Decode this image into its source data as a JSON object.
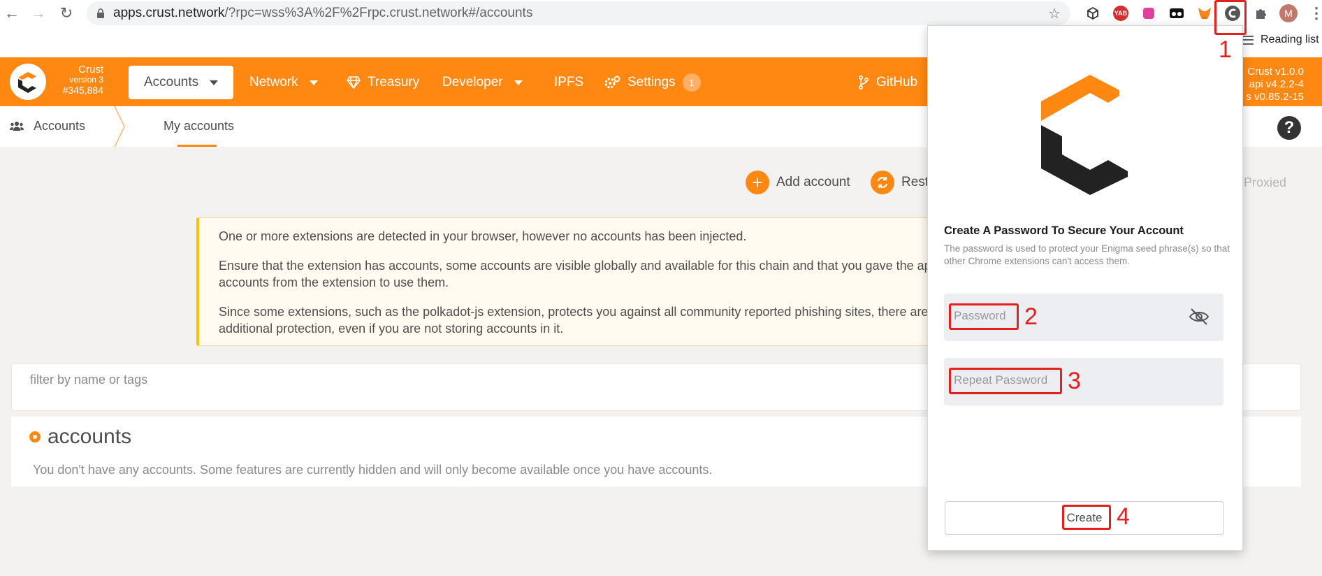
{
  "browser": {
    "url_host": "apps.crust.network",
    "url_path": "/?rpc=wss%3A%2F%2Frpc.crust.network#/accounts",
    "reading_list": "Reading list",
    "profile_initial": "M",
    "ext_yab_label": "YAB"
  },
  "header": {
    "chain_name": "Crust",
    "chain_version": "version 3",
    "block": "#345,884",
    "menu": {
      "accounts": "Accounts",
      "network": "Network",
      "treasury": "Treasury",
      "developer": "Developer",
      "ipfs": "IPFS",
      "settings": "Settings",
      "settings_badge": "1",
      "github": "GitHub"
    },
    "versions": [
      "Crust v1.0.0",
      "api v4.2.2-4",
      "s v0.85.2-15"
    ]
  },
  "subheader": {
    "section": "Accounts",
    "tab": "My accounts"
  },
  "actions": {
    "add_account": "Add account",
    "restore": "Resto",
    "proxied": "Proxied"
  },
  "warning": {
    "p1": "One or more extensions are detected in your browser, however no accounts has been injected.",
    "p2a": "Ensure that the extension has accounts, some accounts are visible globally and available for this chain and that you gave the applica",
    "p2b": "accounts from the extension to use them.",
    "p3a": "Since some extensions, such as the polkadot-js extension, protects you against all community reported phishing sites, there are vali",
    "p3b": "additional protection, even if you are not storing accounts in it."
  },
  "filter": {
    "placeholder": "filter by name or tags"
  },
  "accounts": {
    "title": "accounts",
    "empty": "You don't have any accounts. Some features are currently hidden and will only become available once you have accounts."
  },
  "popup": {
    "title": "Create A Password To Secure Your Account",
    "desc": "The password is used to protect your Enigma seed phrase(s) so that other Chrome extensions can't access them.",
    "password_placeholder": "Password",
    "repeat_placeholder": "Repeat Password",
    "create_label": "Create"
  },
  "annotations": {
    "n1": "1",
    "n2": "2",
    "n3": "3",
    "n4": "4"
  },
  "colors": {
    "accent": "#ff8812",
    "annotation": "#e3201b"
  }
}
